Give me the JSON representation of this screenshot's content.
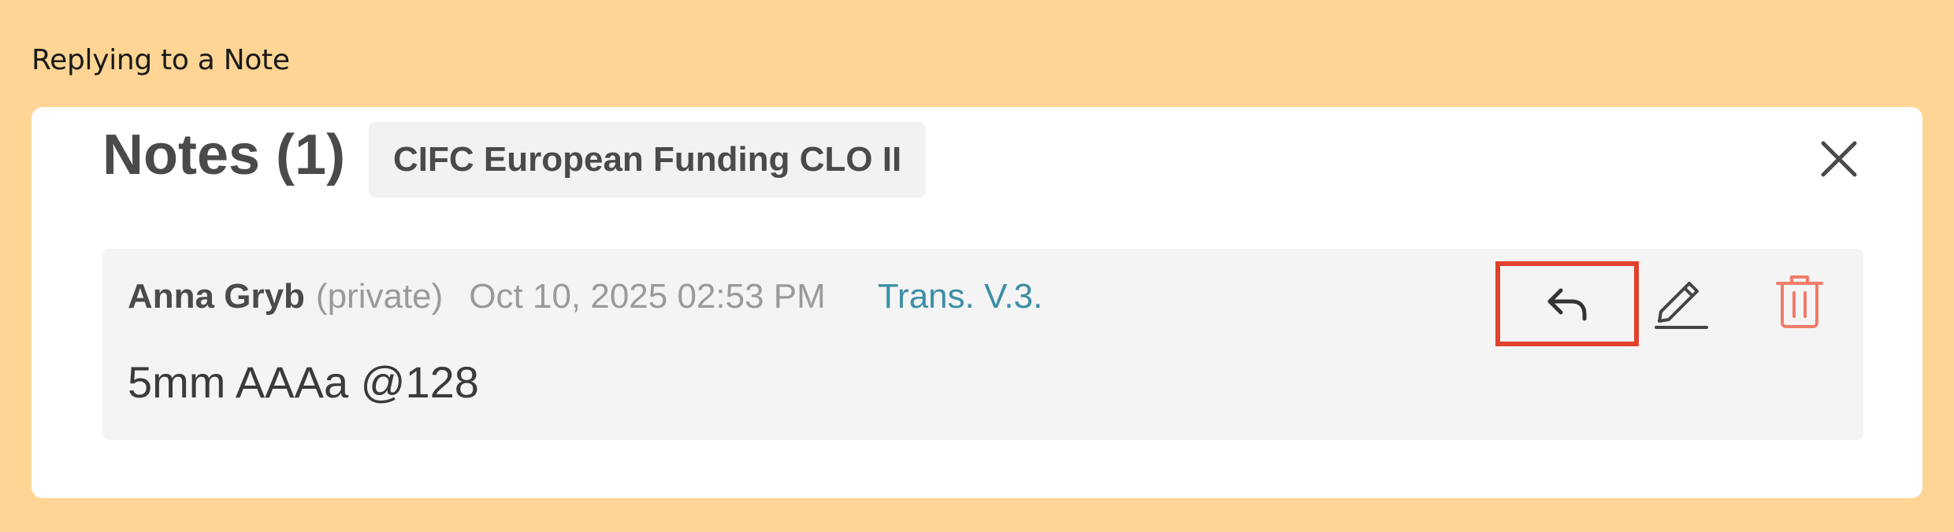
{
  "caption": "Replying to a Note",
  "panel": {
    "title": "Notes (1)",
    "deal_name": "CIFC European Funding CLO II",
    "close_icon": "close-icon"
  },
  "note": {
    "author": "Anna Gryb",
    "privacy": "(private)",
    "timestamp": "Oct 10, 2025 02:53 PM",
    "version_link": "Trans. V.3.",
    "body": "5mm AAAa @128",
    "actions": {
      "reply_icon": "reply-arrow-icon",
      "edit_icon": "pencil-icon",
      "delete_icon": "trash-icon",
      "highlighted": "reply"
    }
  },
  "colors": {
    "background": "#fed594",
    "card": "#ffffff",
    "note_bg": "#f4f4f4",
    "link": "#3d8fa5",
    "delete": "#f07c68",
    "highlight": "#e1412d"
  }
}
